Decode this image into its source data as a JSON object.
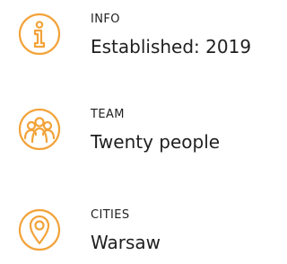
{
  "accent_color": "#F2A33A",
  "items": [
    {
      "icon": "info-icon",
      "label": "INFO",
      "value": "Established: 2019"
    },
    {
      "icon": "team-icon",
      "label": "TEAM",
      "value": "Twenty people"
    },
    {
      "icon": "location-pin-icon",
      "label": "CITIES",
      "value": "Warsaw"
    }
  ]
}
